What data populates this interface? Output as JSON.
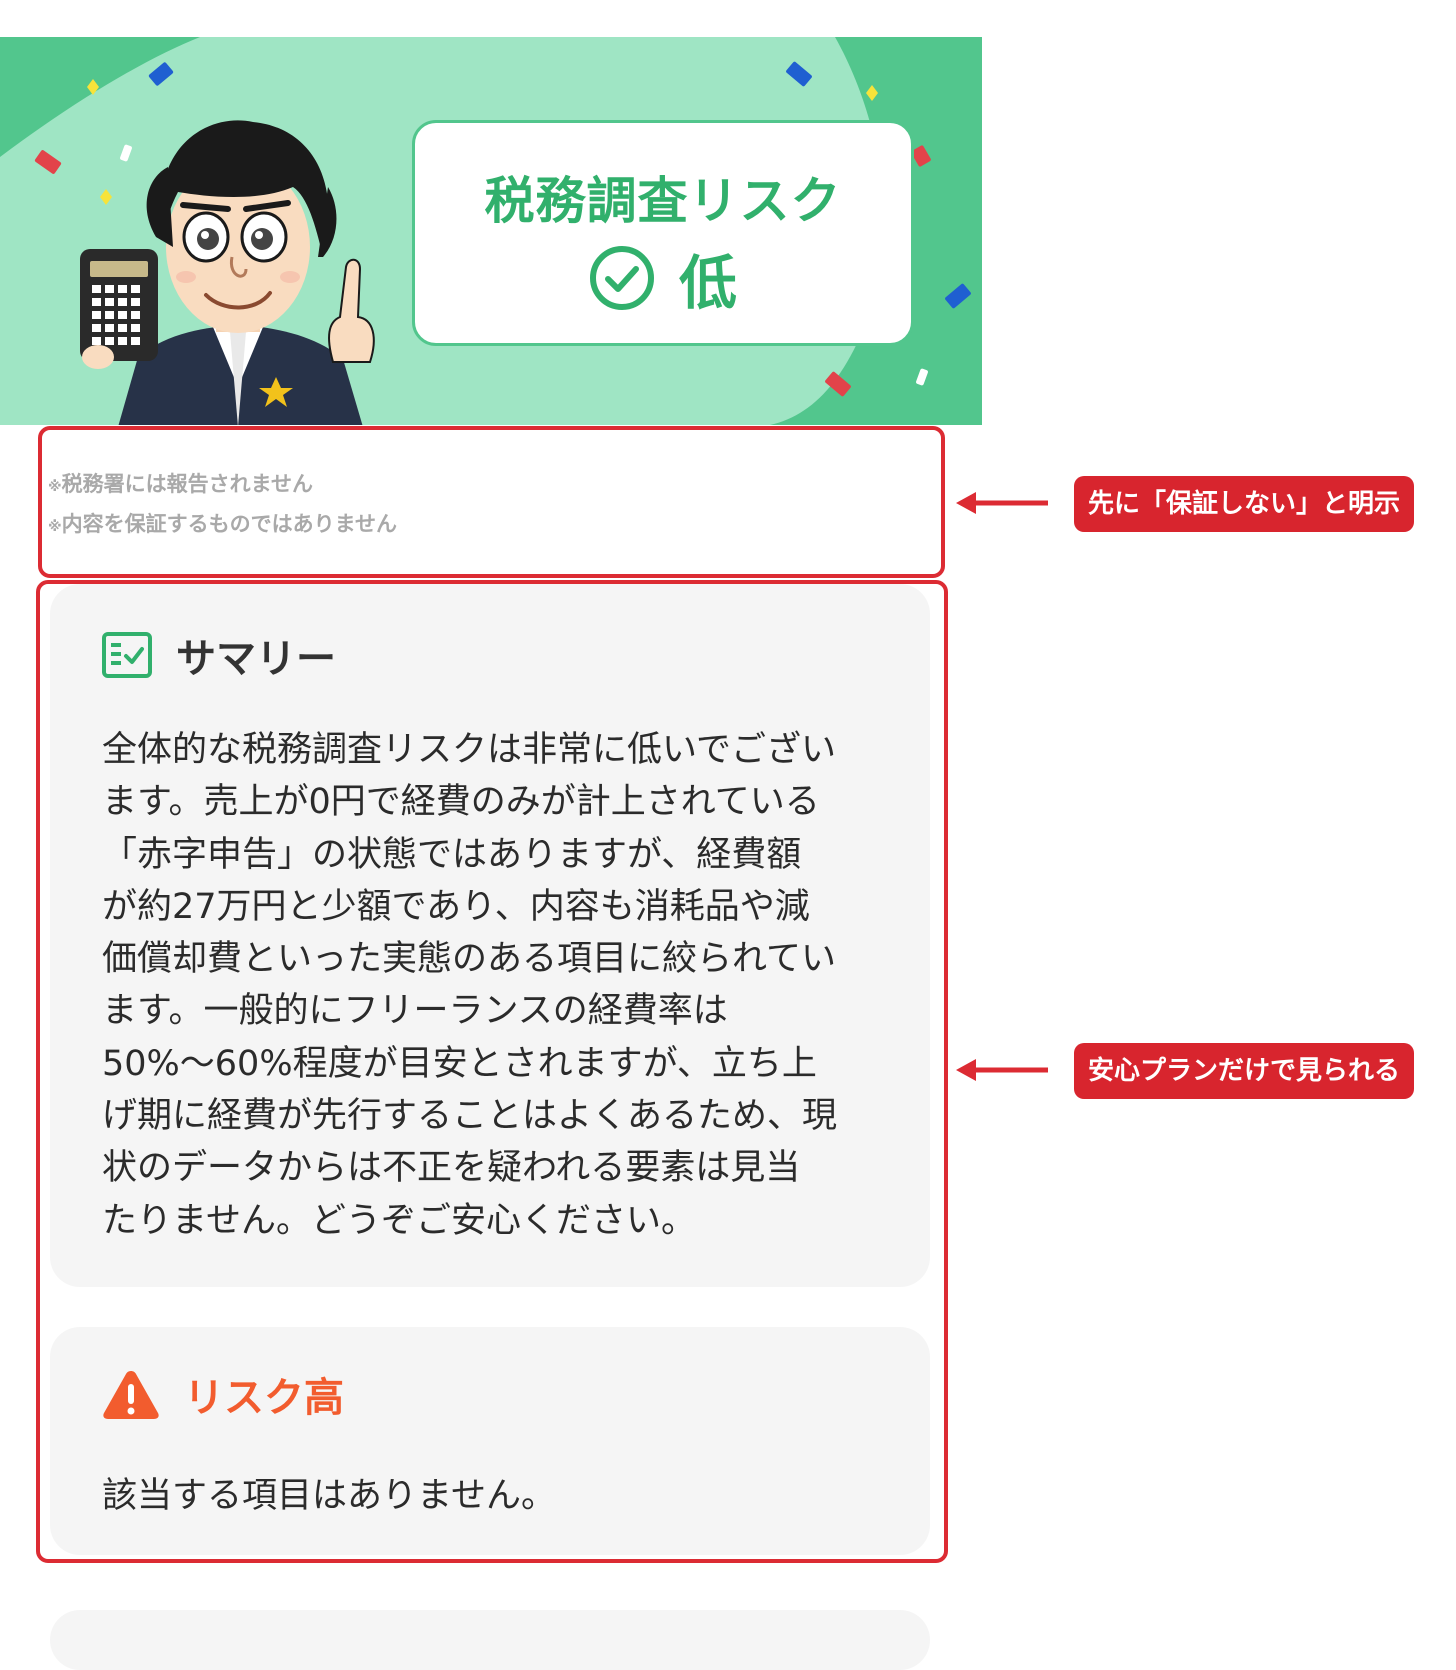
{
  "banner": {
    "result_title": "税務調査リスク",
    "result_value": "低",
    "colors": {
      "banner": "#52c68d",
      "accent": "#31b06c"
    }
  },
  "disclaimer": {
    "line1": "税務署には報告されません",
    "line2": "内容を保証するものではありません",
    "mark": "※"
  },
  "annotations": {
    "label1": "先に「保証しない」と明示",
    "label2": "安心プランだけで見られる",
    "color": "#dc2b33"
  },
  "summary": {
    "icon": "summary-checklist-icon",
    "title": "サマリー",
    "lines": [
      "全体的な税務調査リスクは非常に低いでござい",
      "ます。売上が0円で経費のみが計上されている",
      "「赤字申告」の状態ではありますが、経費額",
      "が約27万円と少額であり、内容も消耗品や減",
      "価償却費といった実態のある項目に絞られてい",
      "ます。一般的にフリーランスの経費率は",
      "50%〜60%程度が目安とされますが、立ち上",
      "げ期に経費が先行することはよくあるため、現",
      "状のデータからは不正を疑われる要素は見当",
      "たりません。どうぞご安心ください。"
    ]
  },
  "risk_high": {
    "icon": "warning-triangle-icon",
    "title": "リスク高",
    "text": "該当する項目はありません。",
    "color": "#f25c2e"
  }
}
